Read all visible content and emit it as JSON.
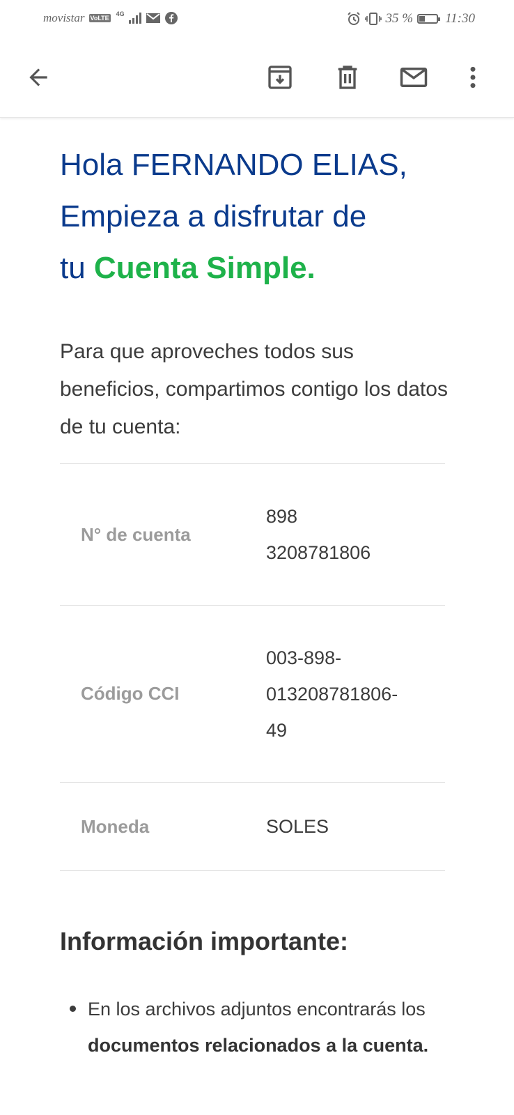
{
  "status_bar": {
    "carrier": "movistar",
    "volte": "VoLTE",
    "network": "4G",
    "battery_text": "35 %",
    "battery_level": 0.35,
    "time": "11:30"
  },
  "app_bar": {
    "icons": [
      "back-arrow-icon",
      "archive-icon",
      "delete-icon",
      "mark-unread-icon",
      "more-vert-icon"
    ]
  },
  "email": {
    "greeting_line1": "Hola FERNANDO ELIAS,",
    "greeting_line2": "Empieza a disfrutar de",
    "greeting_line3_prefix": "tu ",
    "greeting_accent": "Cuenta Simple.",
    "accent_color": "#1eb24a",
    "title_color": "#0a3a8c",
    "intro": "Para que aproveches todos sus beneficios, compartimos contigo los datos de tu cuenta:",
    "account_rows": [
      {
        "label": "N° de cuenta",
        "value_lines": [
          "898",
          "3208781806"
        ]
      },
      {
        "label": "Código CCI",
        "value_lines": [
          "003-898-",
          "013208781806-",
          "49"
        ]
      },
      {
        "label": "Moneda",
        "value_lines": [
          "SOLES"
        ]
      }
    ],
    "info_title": "Información importante:",
    "info_items": [
      {
        "prefix": "En los archivos adjuntos encontrarás los ",
        "bold": "documentos relacionados a la cuenta."
      }
    ]
  }
}
